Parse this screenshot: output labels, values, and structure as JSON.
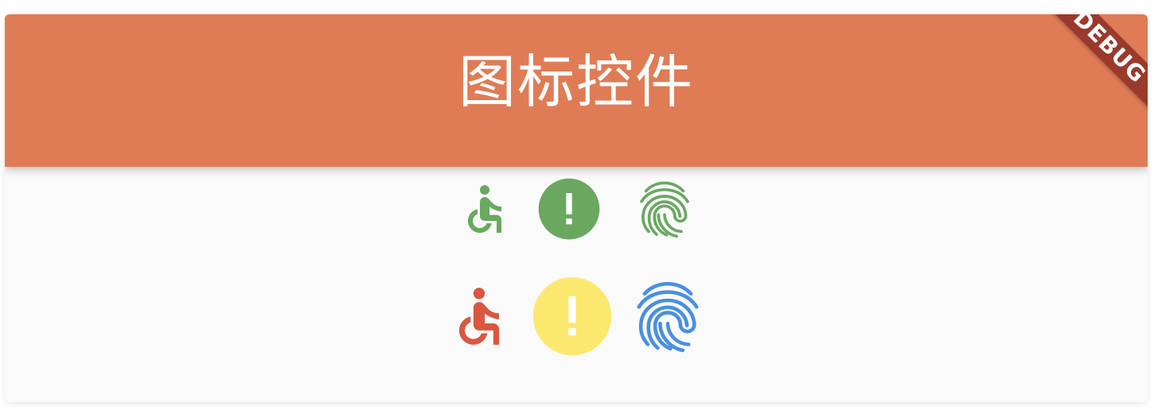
{
  "appbar": {
    "title": "图标控件",
    "color": "#df7c56"
  },
  "debug_banner": {
    "label": "DEBUG",
    "color": "#9a3a2c"
  },
  "icon_rows": [
    {
      "icons": [
        {
          "name": "accessible-icon",
          "color": "#6aa860"
        },
        {
          "name": "error-icon",
          "color": "#6aa860"
        },
        {
          "name": "fingerprint-icon",
          "color": "#6aa860"
        }
      ]
    },
    {
      "icons": [
        {
          "name": "accessible-icon",
          "color": "#d9573f"
        },
        {
          "name": "error-icon",
          "color": "#fce86f"
        },
        {
          "name": "fingerprint-icon",
          "color": "#4a8fe0"
        }
      ]
    }
  ]
}
